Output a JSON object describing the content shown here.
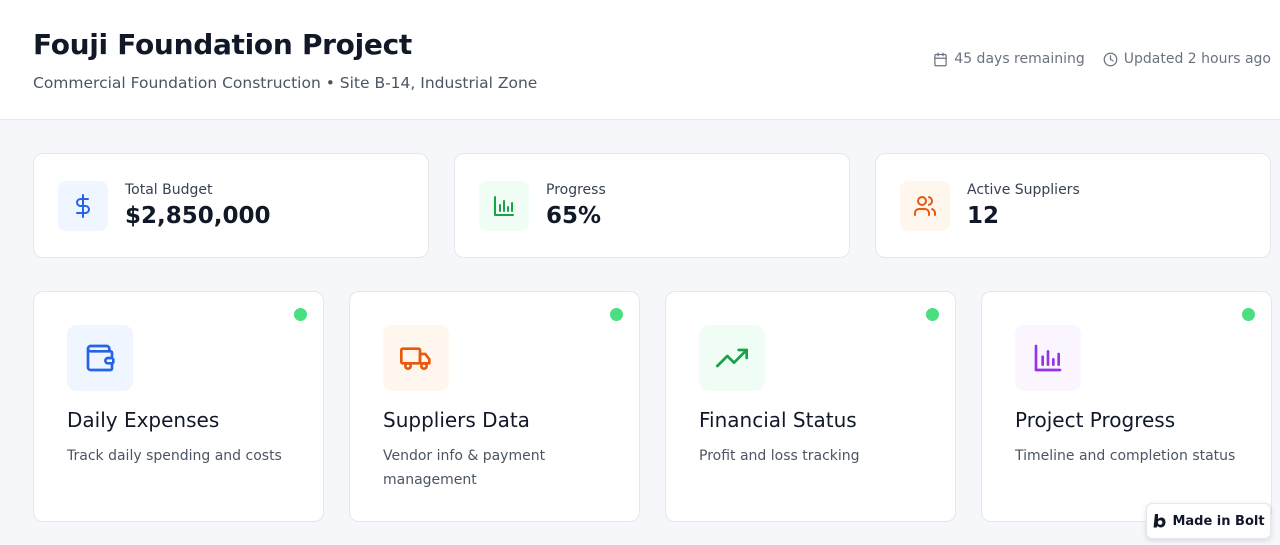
{
  "header": {
    "title": "Fouji Foundation Project",
    "subtitle": "Commercial Foundation Construction • Site B-14, Industrial Zone",
    "days_remaining": "45 days remaining",
    "updated": "Updated 2 hours ago"
  },
  "stats": [
    {
      "label": "Total Budget",
      "value": "$2,850,000",
      "icon": "dollar-icon",
      "accent": "#2563eb"
    },
    {
      "label": "Progress",
      "value": "65%",
      "icon": "bar-chart-icon",
      "accent": "#16a34a"
    },
    {
      "label": "Active Suppliers",
      "value": "12",
      "icon": "users-icon",
      "accent": "#ea580c"
    }
  ],
  "features": [
    {
      "title": "Daily Expenses",
      "description": "Track daily spending and costs",
      "icon": "wallet-icon",
      "accent": "#2563eb",
      "status_color": "#4ade80"
    },
    {
      "title": "Suppliers Data",
      "description": "Vendor info & payment management",
      "icon": "truck-icon",
      "accent": "#ea580c",
      "status_color": "#4ade80"
    },
    {
      "title": "Financial Status",
      "description": "Profit and loss tracking",
      "icon": "trending-up-icon",
      "accent": "#16a34a",
      "status_color": "#4ade80"
    },
    {
      "title": "Project Progress",
      "description": "Timeline and completion status",
      "icon": "bar-chart-icon",
      "accent": "#9333ea",
      "status_color": "#4ade80"
    }
  ],
  "badge": {
    "label": "Made in Bolt",
    "icon": "bolt-logo-icon"
  }
}
